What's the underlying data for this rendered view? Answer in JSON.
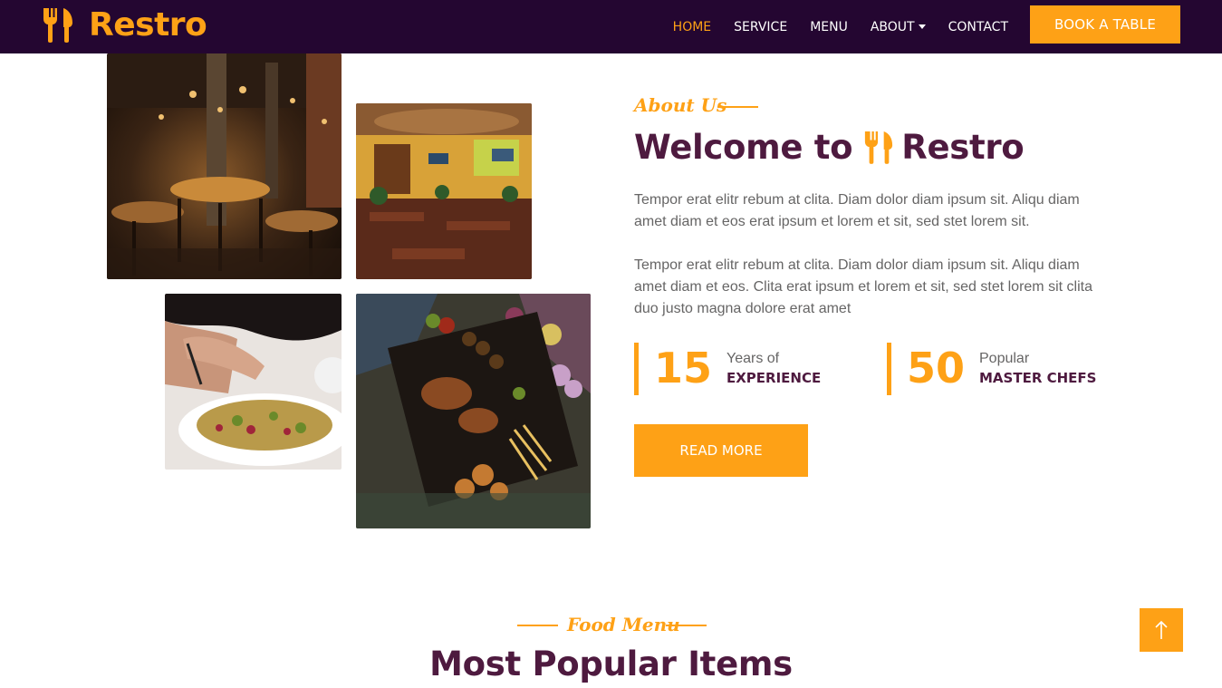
{
  "navbar": {
    "brand": "Restro",
    "brand_icon": "fork-knife-icon",
    "links": [
      {
        "label": "HOME",
        "active": true
      },
      {
        "label": "SERVICE",
        "active": false
      },
      {
        "label": "MENU",
        "active": false
      },
      {
        "label": "ABOUT",
        "active": false,
        "dropdown": true
      },
      {
        "label": "CONTACT",
        "active": false
      }
    ],
    "cta": "BOOK A TABLE"
  },
  "gallery": {
    "images": [
      "restaurant-interior-photo",
      "restaurant-dining-room-photo",
      "salad-plate-photo",
      "food-platter-photo"
    ]
  },
  "about": {
    "tag": "About Us",
    "title_prefix": "Welcome to",
    "title_brand": "Restro",
    "paragraph1": "Tempor erat elitr rebum at clita. Diam dolor diam ipsum sit. Aliqu diam amet diam et eos erat ipsum et lorem et sit, sed stet lorem sit.",
    "paragraph2": "Tempor erat elitr rebum at clita. Diam dolor diam ipsum sit. Aliqu diam amet diam et eos. Clita erat ipsum et lorem et sit, sed stet lorem sit clita duo justo magna dolore erat amet",
    "stats": [
      {
        "number": "15",
        "small": "Years of",
        "big": "EXPERIENCE"
      },
      {
        "number": "50",
        "small": "Popular",
        "big": "MASTER CHEFS"
      }
    ],
    "button": "READ MORE"
  },
  "menu_section": {
    "tag": "Food Menu",
    "title": "Most Popular Items"
  },
  "back_to_top_icon": "arrow-up-icon",
  "colors": {
    "primary": "#FEA116",
    "dark": "#240631",
    "heading": "#4e1a3f",
    "body_text": "#666565"
  }
}
